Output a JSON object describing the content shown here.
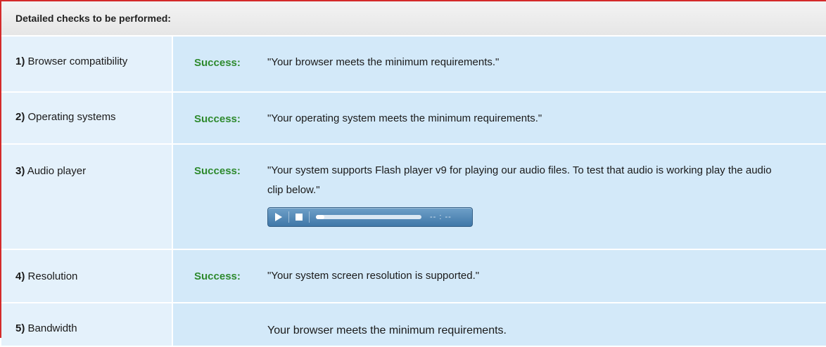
{
  "header": {
    "title": "Detailed checks to be performed:"
  },
  "checks": [
    {
      "num": "1)",
      "label": "Browser compatibility",
      "status": "Success:",
      "message": "\"Your browser meets the minimum requirements.\""
    },
    {
      "num": "2)",
      "label": "Operating systems",
      "status": "Success:",
      "message": "\"Your operating system meets the minimum requirements.\""
    },
    {
      "num": "3)",
      "label": "Audio player",
      "status": "Success:",
      "message": "\"Your system supports Flash player v9 for playing our audio files. To test that audio is working play the audio clip below.\""
    },
    {
      "num": "4)",
      "label": "Resolution",
      "status": "Success:",
      "message": "\"Your system screen resolution is supported.\""
    },
    {
      "num": "5)",
      "label": "Bandwidth",
      "status": "",
      "message": "Your browser meets the minimum requirements."
    }
  ],
  "player": {
    "time": "-- : --",
    "progress": 0.08,
    "icons": [
      "play-icon",
      "stop-icon"
    ]
  },
  "colors": {
    "success": "#2e8a2e",
    "border": "#d42a2a",
    "row_label_bg": "#e4f1fb",
    "row_result_bg": "#d3e9f9"
  }
}
